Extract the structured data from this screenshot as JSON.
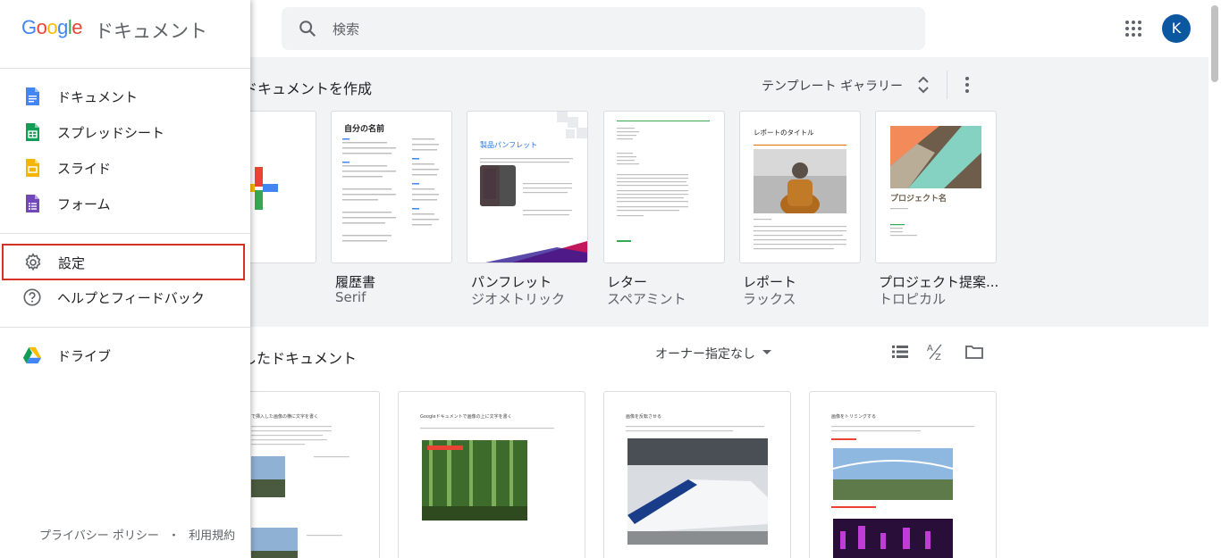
{
  "header": {
    "search_placeholder": "検索",
    "avatar_letter": "K"
  },
  "drawer": {
    "brand": "Google",
    "app_name": "ドキュメント",
    "items": [
      {
        "label": "ドキュメント",
        "icon": "docs-icon",
        "color": "#4285f4"
      },
      {
        "label": "スプレッドシート",
        "icon": "sheets-icon",
        "color": "#0f9d58"
      },
      {
        "label": "スライド",
        "icon": "slides-icon",
        "color": "#f4b400"
      },
      {
        "label": "フォーム",
        "icon": "forms-icon",
        "color": "#7248b9"
      },
      {
        "label": "設定",
        "icon": "gear-icon",
        "selected": true
      },
      {
        "label": "ヘルプとフィードバック",
        "icon": "help-icon"
      },
      {
        "label": "ドライブ",
        "icon": "drive-icon"
      }
    ],
    "footer": {
      "privacy": "プライバシー ポリシー",
      "separator": "・",
      "terms": "利用規約"
    }
  },
  "templates": {
    "section_title": "ドキュメントを作成",
    "gallery_label": "テンプレート ギャラリー",
    "items": [
      {
        "name": "",
        "sub": ""
      },
      {
        "name": "履歴書",
        "sub": "Serif",
        "thumb_title": "自分の名前"
      },
      {
        "name": "パンフレット",
        "sub": "ジオメトリック",
        "thumb_title": "製品パンフレット"
      },
      {
        "name": "レター",
        "sub": "スペアミント"
      },
      {
        "name": "レポート",
        "sub": "ラックス",
        "thumb_title": "レポートのタイトル"
      },
      {
        "name": "プロジェクト提案...",
        "sub": "トロピカル",
        "thumb_title": "プロジェクト名"
      }
    ]
  },
  "recent": {
    "section_title": "したドキュメント",
    "owner_filter": "オーナー指定なし",
    "docs": [
      {
        "thumb_title": "で挿入した画像の横に文字を書く"
      },
      {
        "thumb_title": "Googleドキュメントで画像の上に文字を書く"
      },
      {
        "thumb_title": "画像を反転させる"
      },
      {
        "thumb_title": "画像をトリミングする"
      }
    ]
  },
  "colors": {
    "accent_blue": "#1a73e8",
    "selection_border": "#d93025",
    "band_bg": "#f1f3f4"
  }
}
